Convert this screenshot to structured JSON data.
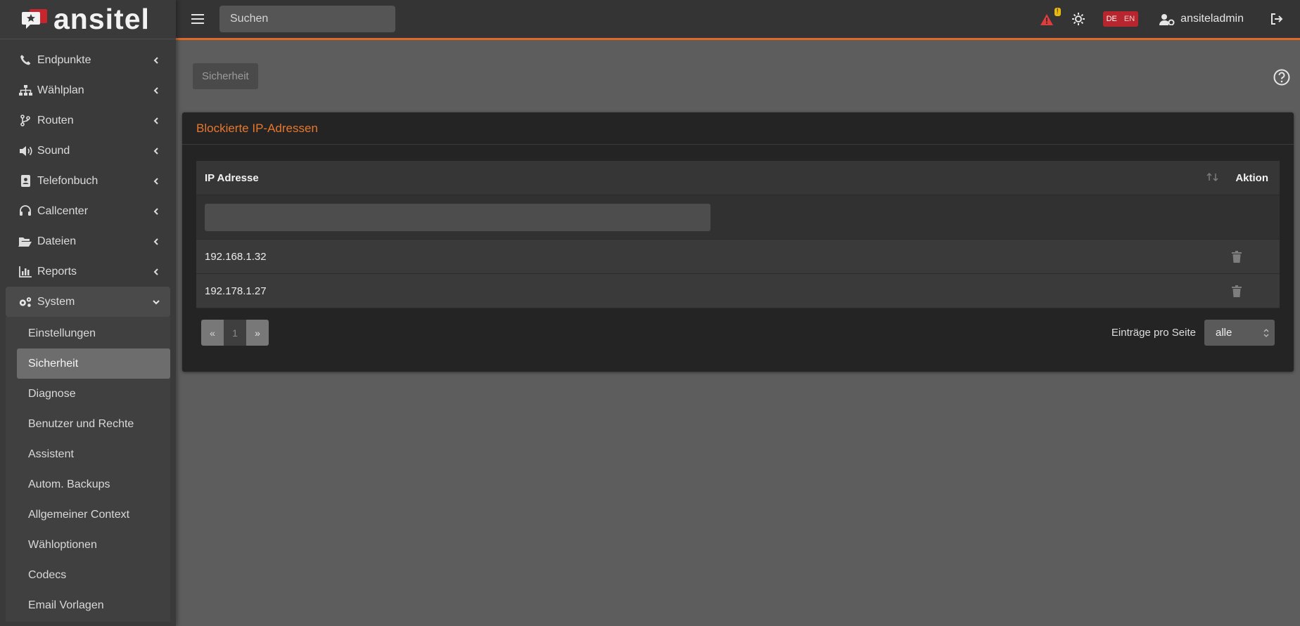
{
  "brand": {
    "name": "ansitel"
  },
  "colors": {
    "accent": "#e2692a",
    "card_title": "#e8772e",
    "alert_icon": "#e23b3b",
    "alert_badge": "#e8b80d",
    "lang_badge": "#b7262f"
  },
  "sidebar": {
    "items": [
      {
        "label": "Endpunkte",
        "icon": "phone-icon"
      },
      {
        "label": "Wählplan",
        "icon": "sitemap-icon"
      },
      {
        "label": "Routen",
        "icon": "branch-icon"
      },
      {
        "label": "Sound",
        "icon": "volume-icon"
      },
      {
        "label": "Telefonbuch",
        "icon": "address-book-icon"
      },
      {
        "label": "Callcenter",
        "icon": "headset-icon"
      },
      {
        "label": "Dateien",
        "icon": "folder-open-icon"
      },
      {
        "label": "Reports",
        "icon": "bar-chart-icon"
      },
      {
        "label": "System",
        "icon": "gears-icon"
      }
    ],
    "system_sub": [
      "Einstellungen",
      "Sicherheit",
      "Diagnose",
      "Benutzer und Rechte",
      "Assistent",
      "Autom. Backups",
      "Allgemeiner Context",
      "Wähloptionen",
      "Codecs",
      "Email Vorlagen"
    ],
    "active_sub": "Sicherheit"
  },
  "topbar": {
    "search_placeholder": "Suchen",
    "alert_count": "!",
    "lang_active": "DE",
    "lang_inactive": "EN",
    "username": "ansiteladmin"
  },
  "page": {
    "breadcrumb": "Sicherheit",
    "card_title": "Blockierte IP-Adressen",
    "table": {
      "col_ip": "IP Adresse",
      "col_action": "Aktion",
      "rows": [
        {
          "ip": "192.168.1.32"
        },
        {
          "ip": "192.178.1.27"
        }
      ]
    },
    "pagination": {
      "prev": "«",
      "current": "1",
      "next": "»"
    },
    "per_page_label": "Einträge pro Seite",
    "per_page_value": "alle"
  }
}
